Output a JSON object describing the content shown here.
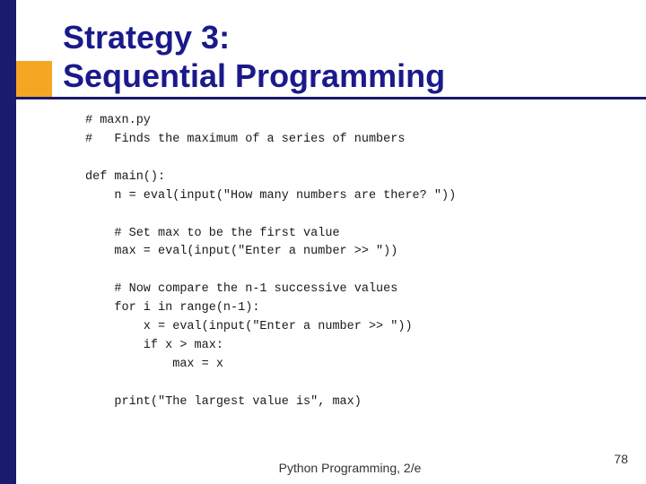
{
  "slide": {
    "title_line1": "Strategy 3:",
    "title_line2": "Sequential Programming"
  },
  "code": {
    "lines": [
      "# maxn.py",
      "#   Finds the maximum of a series of numbers",
      "",
      "def main():",
      "    n = eval(input(\"How many numbers are there? \"))",
      "",
      "    # Set max to be the first value",
      "    max = eval(input(\"Enter a number >> \"))",
      "",
      "    # Now compare the n-1 successive values",
      "    for i in range(n-1):",
      "        x = eval(input(\"Enter a number >> \"))",
      "        if x > max:",
      "            max = x",
      "",
      "    print(\"The largest value is\", max)"
    ]
  },
  "footer": {
    "text": "Python Programming, 2/e",
    "page": "78"
  }
}
